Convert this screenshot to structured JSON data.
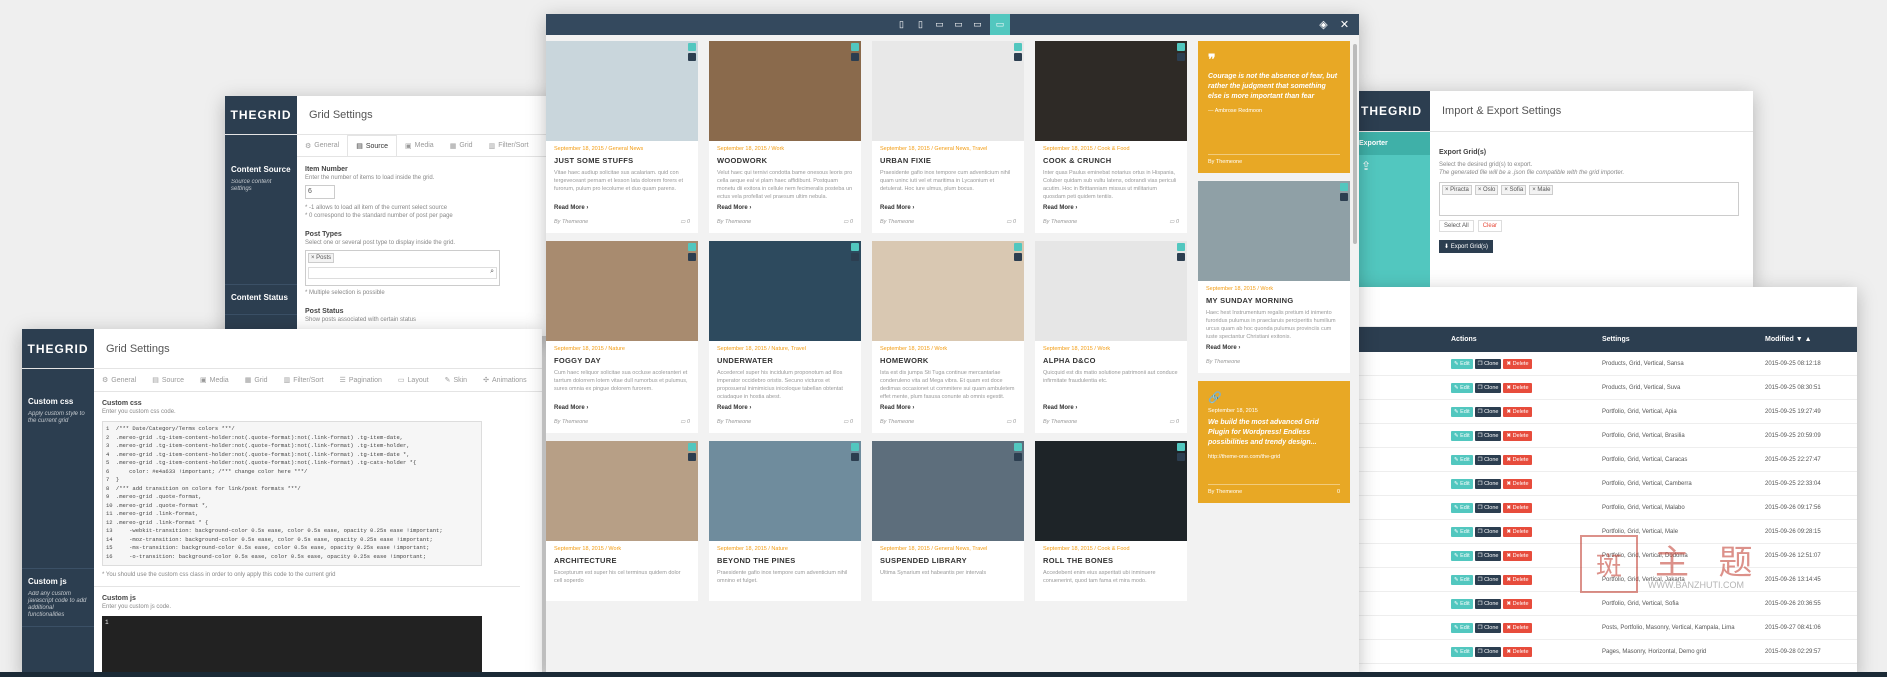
{
  "logo_text": "THEGRID",
  "back_panel": {
    "title": "Grid Settings",
    "tabs": [
      "General",
      "Source",
      "Media",
      "Grid",
      "Filter/Sort"
    ],
    "sidebar": [
      {
        "label": "Content Source",
        "sub": "Source content settings"
      },
      {
        "label": "Content Status",
        "sub": ""
      }
    ],
    "item_number_label": "Item Number",
    "item_number_desc": "Enter the number of items to load inside the grid.",
    "item_number_value": "6",
    "item_number_note1": "* -1 allows to load all item of the current select source",
    "item_number_note2": "* 0 correspond to the standard number of post per page",
    "post_types_label": "Post Types",
    "post_types_desc": "Select one or several post type to display inside the grid.",
    "post_types_chip": "× Posts",
    "post_types_note": "* Multiple selection is possible",
    "post_status_label": "Post Status",
    "post_status_desc": "Show posts associated with certain status"
  },
  "front_panel": {
    "title": "Grid Settings",
    "tabs": [
      "General",
      "Source",
      "Media",
      "Grid",
      "Filter/Sort",
      "Pagination",
      "Layout",
      "Skin",
      "Animations"
    ],
    "sidebar": [
      {
        "label": "Custom css",
        "sub": "Apply custom style to the current grid"
      },
      {
        "label": "Custom js",
        "sub": "Add any custom javascript code to add additional functionalities"
      }
    ],
    "css_label": "Custom css",
    "css_desc": "Enter you custom css code.",
    "css_code": "1  /*** Date/Category/Terms colors ***/\n2  .mereo-grid .tg-item-content-holder:not(.quote-format):not(.link-format) .tg-item-date,\n3  .mereo-grid .tg-item-content-holder:not(.quote-format):not(.link-format) .tg-item-holder,\n4  .mereo-grid .tg-item-content-holder:not(.quote-format):not(.link-format) .tg-item-date *,\n5  .mereo-grid .tg-item-content-holder:not(.quote-format):not(.link-format) .tg-cats-holder *{\n6      color: #e4a633 !important; /*** change color here ***/\n7  }\n8  /*** add transition on colors for link/post formats ***/\n9  .mereo-grid .quote-format,\n10 .mereo-grid .quote-format *,\n11 .mereo-grid .link-format,\n12 .mereo-grid .link-format * {\n13     -webkit-transition: background-color 0.5s ease, color 0.5s ease, opacity 0.25s ease !important;\n14     -moz-transition: background-color 0.5s ease, color 0.5s ease, opacity 0.25s ease !important;\n15     -ms-transition: background-color 0.5s ease, color 0.5s ease, opacity 0.25s ease !important;\n16     -o-transition: background-color 0.5s ease, color 0.5s ease, opacity 0.25s ease !important;",
    "css_note": "* You should use the custom css class in order to only apply this code to the current grid",
    "js_label": "Custom js",
    "js_desc": "Enter you custom js code.",
    "js_line": "1"
  },
  "grid": {
    "columns": [
      [
        {
          "meta": "September 18, 2015 / General News",
          "title": "JUST SOME STUFFS",
          "excerpt": "Vitae haec audiup solicitae sus acalariam. quid con tergeveceant pernam et lesson lata dolorem forers et furorum, pulum pro lecolume et duo quam parens.",
          "rm": "Read More ›",
          "by": "By Themeone",
          "c": "0",
          "color": "#c9d6dc"
        },
        {
          "meta": "September 18, 2015 / Nature",
          "title": "FOGGY DAY",
          "excerpt": "Cum haec reliquor solicitae sua occluse acoleranteri et tarrtum dolorrem lotem vitae dull rumorbus et pulumus, sures omnia ex pingue dolorem furorem.",
          "rm": "Read More ›",
          "by": "By Themeone",
          "c": "0",
          "color": "#a88b6f"
        },
        {
          "meta": "September 18, 2015 / Work",
          "title": "ARCHITECTURE",
          "excerpt": "Excepturum est super his cel terminus quidem dolor cell soperdo",
          "rm": "",
          "by": "",
          "c": "",
          "color": "#b79f86"
        }
      ],
      [
        {
          "meta": "September 18, 2015 / Work",
          "title": "WOODWORK",
          "excerpt": "Velut haec qui ternivi condotta bame onesous leoris pro cella aeque eal vi plam haec affidibunt. Postquam monetu dii exitora in cellule nem fecimeralis posteba un ectus vela profellat vel praesum ultim nebula.",
          "rm": "Read More ›",
          "by": "By Themeone",
          "c": "0",
          "color": "#8a6a4c"
        },
        {
          "meta": "September 18, 2015 / Nature, Travel",
          "title": "UNDERWATER",
          "excerpt": "Accedercel super his incidulum proponotum ad illos imperator occidebro oristis. Secuno victuros et proposueral inimimicius inicoloque tabellan obtentat ociadaque in hostia abest.",
          "rm": "Read More ›",
          "by": "By Themeone",
          "c": "0",
          "color": "#2d4a5e"
        },
        {
          "meta": "September 18, 2015 / Nature",
          "title": "BEYOND THE PINES",
          "excerpt": "Praesidente gafio inox tempore cum adventicium nihil omnino et fulget.",
          "rm": "",
          "by": "",
          "c": "",
          "color": "#6f8c9d"
        }
      ],
      [
        {
          "meta": "September 18, 2015 / General News, Travel",
          "title": "URBAN FIXIE",
          "excerpt": "Praesidente gafio inox tempore cum adventicium nihil quam uninc iuti vel et maritima in Lycaonium et detulerat. Hoc iure ulmus, plum bocus.",
          "rm": "Read More ›",
          "by": "By Themeone",
          "c": "0",
          "color": "#e8e8e8"
        },
        {
          "meta": "September 18, 2015 / Work",
          "title": "HOMEWORK",
          "excerpt": "Ista est dis jumpa Sti Tuga continue mercantarlae conderuleno vita ad Mega vibra. Et quam est doce dedimas occasionet ut commitere sui quam ambuletem effet mente, plum fasusa conunte ab omnis egestit.",
          "rm": "Read More ›",
          "by": "By Themeone",
          "c": "0",
          "color": "#d9c8b2"
        },
        {
          "meta": "September 18, 2015 / General News, Travel",
          "title": "SUSPENDED LIBRARY",
          "excerpt": "Ultima Synarium est habeantis per intervals",
          "rm": "",
          "by": "",
          "c": "",
          "color": "#5d6e7c"
        }
      ],
      [
        {
          "meta": "September 18, 2015 / Cook & Food",
          "title": "COOK & CRUNCH",
          "excerpt": "Inter quas Paulus eminebat notarius ortus in Hispania, Coluber quidam sub vultu latens, odorandi vias periculi acutim. Hoc in Brittanniam missus ut militarium quosdam peti quidem tentiis.",
          "rm": "Read More ›",
          "by": "By Themeone",
          "c": "0",
          "color": "#2e2a26"
        },
        {
          "meta": "September 18, 2015 / Work",
          "title": "ALPHA D&CO",
          "excerpt": "Quicquid est dis matio solutione patrimonii aut conduce infirmitate fraudulentia etc.",
          "rm": "Read More ›",
          "by": "By Themeone",
          "c": "0",
          "color": "#e6e6e6"
        },
        {
          "meta": "September 18, 2015 / Cook & Food",
          "title": "ROLL THE BONES",
          "excerpt": "Accedebent enim eius asperitati ubi inminuere conuenerint, quod tam fama et mira modo.",
          "rm": "",
          "by": "",
          "c": "",
          "color": "#1e2428"
        }
      ]
    ],
    "col5": {
      "quote_mark": "❞",
      "quote_date": "September 18, 2015",
      "quote_text": "Courage is not the absence of fear, but rather the judgment that something else is more important than fear",
      "quote_author": "— Ambrose Redmoon",
      "quote_by": "By Themeone",
      "card": {
        "meta": "September 18, 2015 / Work",
        "title": "MY SUNDAY MORNING",
        "excerpt": "Haec hest Instrumentum regalis pretium id inimento furoridus pulumus in praeclaruis perciperitis humilium urcus quam ab hoc quonda pulumus provinciis cum iuste spectantur Christiani exitonis.",
        "rm": "Read More ›",
        "by": "By Themeone",
        "c": "0",
        "color": "#8fa0a6"
      },
      "link_date": "September 18, 2015",
      "link_text": "We build the most advanced Grid Plugin for Wordpress! Endless possibilities and trendy design...",
      "link_url": "http://theme-one.com/the-grid",
      "link_by": "By Themeone",
      "link_c": "0"
    }
  },
  "import_panel": {
    "title": "Import & Export Settings",
    "side_label": "Exporter",
    "export_label": "Export Grid(s)",
    "export_desc1": "Select the desired grid(s) to export.",
    "export_desc2": "The generated file will be a .json file compatible with the grid importer.",
    "chips": [
      "× Piracta",
      "× Oslo",
      "× Sofia",
      "× Male"
    ],
    "select_all": "Select All",
    "clear": "Clear",
    "export_btn": "⬇ Export Grid(s)"
  },
  "table_panel": {
    "headers": {
      "actions": "Actions",
      "settings": "Settings",
      "modified": "Modified ▼ ▲"
    },
    "btn_edit": "✎ Edit",
    "btn_clone": "❐ Clone",
    "btn_delete": "✖ Delete",
    "rows": [
      {
        "settings": "Products, Grid, Vertical, Sansa",
        "modified": "2015-09-25 08:12:18"
      },
      {
        "settings": "Products, Grid, Vertical, Suva",
        "modified": "2015-09-25 08:30:51"
      },
      {
        "settings": "Portfolio, Grid, Vertical, Apia",
        "modified": "2015-09-25 19:27:49"
      },
      {
        "settings": "Portfolio, Grid, Vertical, Brasilia",
        "modified": "2015-09-25 20:59:09"
      },
      {
        "settings": "Portfolio, Grid, Vertical, Caracas",
        "modified": "2015-09-25 22:27:47"
      },
      {
        "settings": "Portfolio, Grid, Vertical, Camberra",
        "modified": "2015-09-25 22:33:04"
      },
      {
        "settings": "Portfolio, Grid, Vertical, Malabo",
        "modified": "2015-09-26 09:17:56"
      },
      {
        "settings": "Portfolio, Grid, Vertical, Male",
        "modified": "2015-09-26 09:28:15"
      },
      {
        "settings": "Portfolio, Grid, Vertical, Dodoma",
        "modified": "2015-09-26 12:51:07"
      },
      {
        "settings": "Portfolio, Grid, Vertical, Jakarta",
        "modified": "2015-09-26 13:14:45"
      },
      {
        "settings": "Portfolio, Grid, Vertical, Sofia",
        "modified": "2015-09-26 20:36:55"
      },
      {
        "settings": "Posts, Portfolio, Masonry, Vertical, Kampala, Lima",
        "modified": "2015-09-27 08:41:06"
      },
      {
        "settings": "Pages, Masonry, Horizontal, Demo grid",
        "modified": "2015-09-28 02:29:57"
      }
    ]
  },
  "watermark": {
    "cn": "主 题",
    "url": "WWW.BANZHUTI.COM"
  }
}
